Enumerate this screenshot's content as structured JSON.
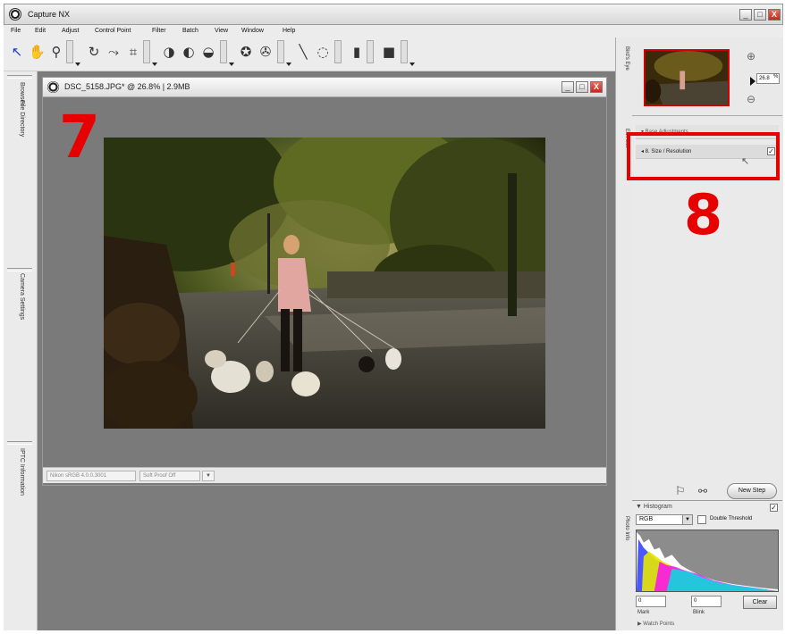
{
  "window": {
    "title": "Capture NX",
    "controls": {
      "minimize": "_",
      "maximize": "□",
      "close": "X"
    }
  },
  "menu": [
    "File",
    "Edit",
    "Adjust",
    "Control Point",
    "Filter",
    "Batch",
    "View",
    "Window",
    "Help"
  ],
  "toolbar": {
    "tools": [
      {
        "icon": "arrow-select-icon",
        "glyph": "↖"
      },
      {
        "icon": "hand-icon",
        "glyph": "✋"
      },
      {
        "icon": "zoom-icon",
        "glyph": "⚲"
      },
      {
        "icon": "rotate-icon",
        "glyph": "↻"
      },
      {
        "icon": "straighten-icon",
        "glyph": "⤳"
      },
      {
        "icon": "crop-icon",
        "glyph": "⌗"
      },
      {
        "icon": "black-point-icon",
        "glyph": "◑"
      },
      {
        "icon": "white-point-icon",
        "glyph": "◐"
      },
      {
        "icon": "neutral-point-icon",
        "glyph": "◒"
      },
      {
        "icon": "red-eye-icon",
        "glyph": "✪"
      },
      {
        "icon": "color-point-icon",
        "glyph": "✇"
      },
      {
        "icon": "brush-icon",
        "glyph": "╲"
      },
      {
        "icon": "lasso-icon",
        "glyph": "◌"
      },
      {
        "icon": "fill-icon",
        "glyph": "▮"
      },
      {
        "icon": "square-icon",
        "glyph": "■"
      }
    ]
  },
  "left_panel": {
    "tabs": [
      "Browser",
      "File Directory",
      "Camera Settings",
      "IPTC Information"
    ]
  },
  "document": {
    "title": "DSC_5158.JPG* @ 26.8% | 2.9MB",
    "status": {
      "color_profile": "Nikon sRGB 4.0.0.3001",
      "soft_proof": "Soft Proof Off"
    },
    "annotation_number": "7"
  },
  "right_panel": {
    "birds_eye_tab": "Bird's Eye",
    "edit_list_tab": "Edit List",
    "photo_info_tab": "Photo Info",
    "zoom": {
      "value": "26.8",
      "unit": "%"
    },
    "edit_steps": [
      {
        "label": "▾ Base Adjustments"
      },
      {
        "label": "◂ 8. Size / Resolution",
        "checked": true
      }
    ],
    "new_step_label": "New Step",
    "annotation_number": "8",
    "highlight_color": "#e60000"
  },
  "histogram": {
    "title": "▼ Histogram",
    "channel": "RGB",
    "double_threshold_label": "Double Threshold",
    "min_value": "0",
    "max_value": "0",
    "min_caption": "Mark",
    "max_caption": "Blink",
    "clear_label": "Clear",
    "photo_info_label": "▶ Watch Points"
  }
}
